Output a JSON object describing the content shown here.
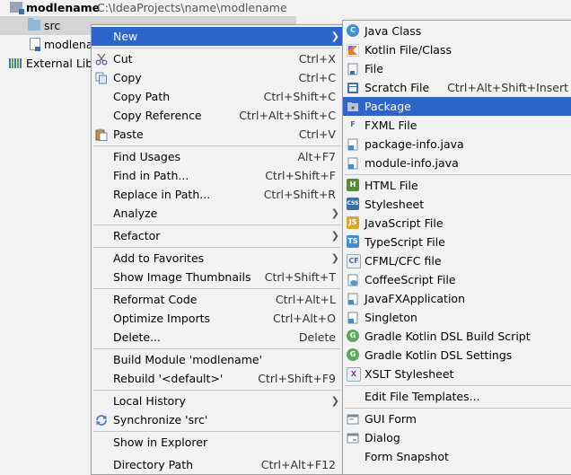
{
  "tree": {
    "project_name": "modlename",
    "project_path": "C:\\IdeaProjects\\name\\modlename",
    "src_label": "src",
    "module_file_label": "modlena",
    "external_libs_label": "External Libr"
  },
  "context_menu": {
    "items": [
      {
        "label": "New",
        "shortcut": "",
        "submenu": true
      },
      {
        "label": "Cut",
        "shortcut": "Ctrl+X"
      },
      {
        "label": "Copy",
        "shortcut": "Ctrl+C"
      },
      {
        "label": "Copy Path",
        "shortcut": "Ctrl+Shift+C"
      },
      {
        "label": "Copy Reference",
        "shortcut": "Ctrl+Alt+Shift+C"
      },
      {
        "label": "Paste",
        "shortcut": "Ctrl+V"
      },
      {
        "label": "Find Usages",
        "shortcut": "Alt+F7"
      },
      {
        "label": "Find in Path...",
        "shortcut": "Ctrl+Shift+F"
      },
      {
        "label": "Replace in Path...",
        "shortcut": "Ctrl+Shift+R"
      },
      {
        "label": "Analyze",
        "shortcut": "",
        "submenu": true
      },
      {
        "label": "Refactor",
        "shortcut": "",
        "submenu": true
      },
      {
        "label": "Add to Favorites",
        "shortcut": "",
        "submenu": true
      },
      {
        "label": "Show Image Thumbnails",
        "shortcut": "Ctrl+Shift+T"
      },
      {
        "label": "Reformat Code",
        "shortcut": "Ctrl+Alt+L"
      },
      {
        "label": "Optimize Imports",
        "shortcut": "Ctrl+Alt+O"
      },
      {
        "label": "Delete...",
        "shortcut": "Delete"
      },
      {
        "label": "Build Module 'modlename'",
        "shortcut": ""
      },
      {
        "label": "Rebuild '<default>'",
        "shortcut": "Ctrl+Shift+F9"
      },
      {
        "label": "Local History",
        "shortcut": "",
        "submenu": true
      },
      {
        "label": "Synchronize 'src'",
        "shortcut": ""
      },
      {
        "label": "Show in Explorer",
        "shortcut": ""
      },
      {
        "label": "Directory Path",
        "shortcut": "Ctrl+Alt+F12"
      }
    ]
  },
  "new_submenu": {
    "items": [
      {
        "label": "Java Class",
        "shortcut": ""
      },
      {
        "label": "Kotlin File/Class",
        "shortcut": ""
      },
      {
        "label": "File",
        "shortcut": ""
      },
      {
        "label": "Scratch File",
        "shortcut": "Ctrl+Alt+Shift+Insert"
      },
      {
        "label": "Package",
        "shortcut": ""
      },
      {
        "label": "FXML File",
        "shortcut": ""
      },
      {
        "label": "package-info.java",
        "shortcut": ""
      },
      {
        "label": "module-info.java",
        "shortcut": ""
      },
      {
        "label": "HTML File",
        "shortcut": ""
      },
      {
        "label": "Stylesheet",
        "shortcut": ""
      },
      {
        "label": "JavaScript File",
        "shortcut": ""
      },
      {
        "label": "TypeScript File",
        "shortcut": ""
      },
      {
        "label": "CFML/CFC file",
        "shortcut": ""
      },
      {
        "label": "CoffeeScript File",
        "shortcut": ""
      },
      {
        "label": "JavaFXApplication",
        "shortcut": ""
      },
      {
        "label": "Singleton",
        "shortcut": ""
      },
      {
        "label": "Gradle Kotlin DSL Build Script",
        "shortcut": ""
      },
      {
        "label": "Gradle Kotlin DSL Settings",
        "shortcut": ""
      },
      {
        "label": "XSLT Stylesheet",
        "shortcut": ""
      },
      {
        "label": "Edit File Templates...",
        "shortcut": ""
      },
      {
        "label": "GUI Form",
        "shortcut": ""
      },
      {
        "label": "Dialog",
        "shortcut": ""
      },
      {
        "label": "Form Snapshot",
        "shortcut": ""
      }
    ]
  },
  "icon_text": {
    "java_class": "C",
    "kotlin": "K",
    "html": "H",
    "css": "CSS",
    "js": "JS",
    "ts": "TS",
    "cfml": "CF",
    "fxml": "F",
    "gradle": "G",
    "xslt": "X"
  },
  "colors": {
    "highlight": "#2f65ca",
    "menu_bg": "#f2f2f2",
    "java_blue": "#3d8fd1",
    "kotlin_orange": "#e07c35",
    "gradle_green": "#5aa85a"
  }
}
